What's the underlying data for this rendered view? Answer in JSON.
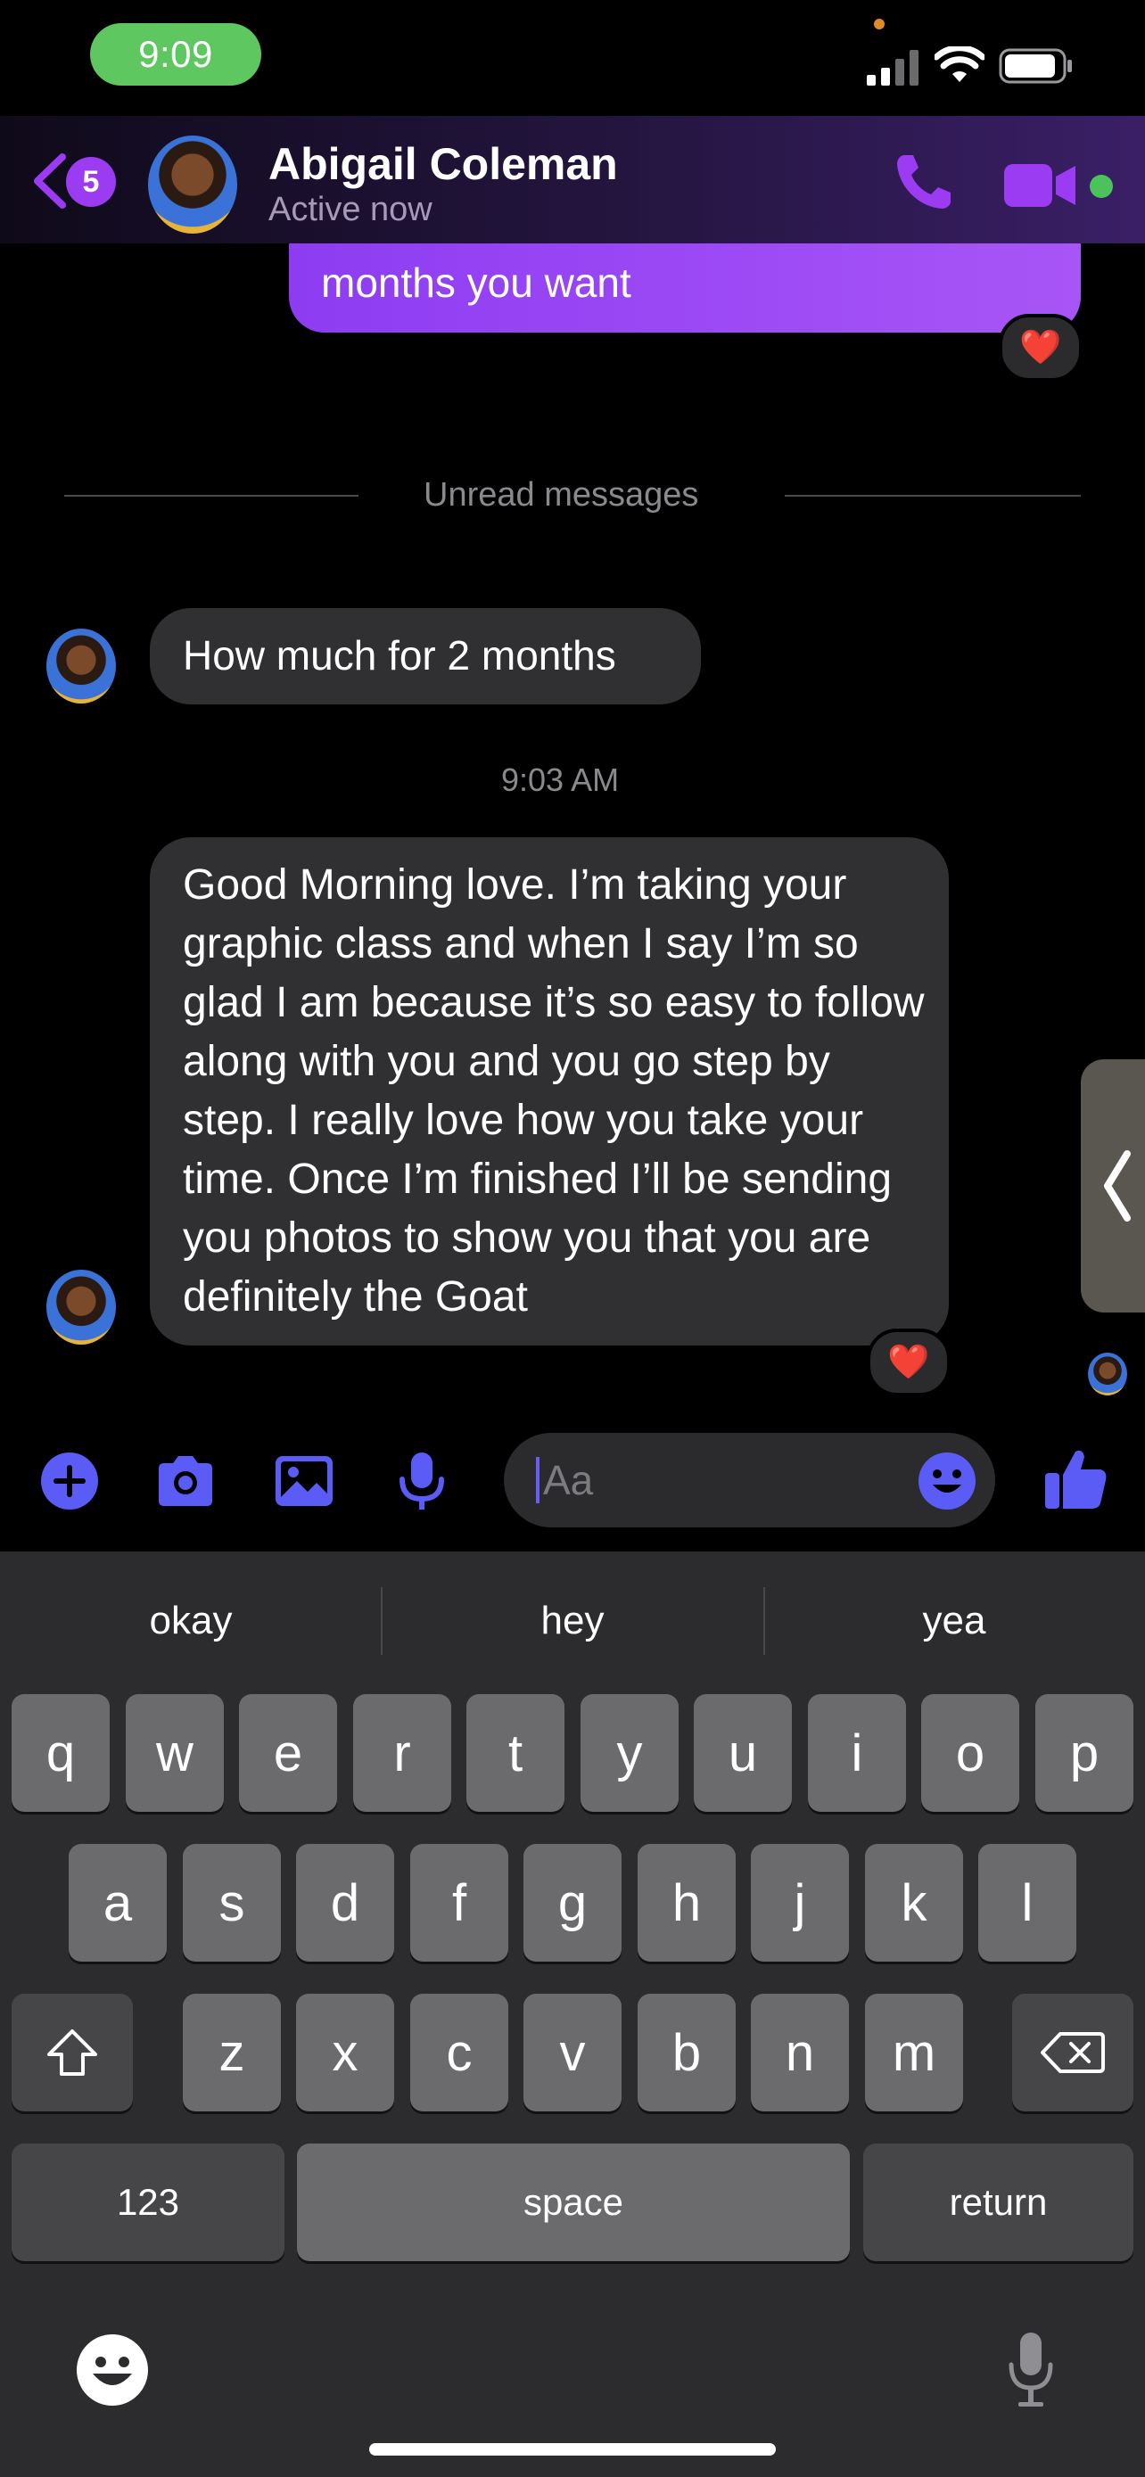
{
  "status_bar": {
    "time": "9:09"
  },
  "header": {
    "back_badge_count": "5",
    "contact_name": "Abigail Coleman",
    "contact_status": "Active now"
  },
  "messages": {
    "outgoing_partial_text": "months you want",
    "unread_divider": "Unread messages",
    "incoming_1": "How much for 2 months",
    "timestamp": "9:03 AM",
    "incoming_2": "Good Morning love. I’m taking your graphic class and when I say I’m so glad I am because it’s so easy to follow along with you and you go step by step. I really love how you take your time. Once I’m finished I’ll be sending you photos to show you that you are definitely the Goat",
    "reaction_emoji": "❤️"
  },
  "composer": {
    "placeholder": "Aa"
  },
  "keyboard": {
    "suggestions": [
      "okay",
      "hey",
      "yea"
    ],
    "row1": [
      "q",
      "w",
      "e",
      "r",
      "t",
      "y",
      "u",
      "i",
      "o",
      "p"
    ],
    "row2": [
      "a",
      "s",
      "d",
      "f",
      "g",
      "h",
      "j",
      "k",
      "l"
    ],
    "row3": [
      "z",
      "x",
      "c",
      "v",
      "b",
      "n",
      "m"
    ],
    "numbers_label": "123",
    "space_label": "space",
    "return_label": "return"
  },
  "colors": {
    "accent_purple": "#8e3cf2",
    "icon_blue": "#5b5cf6",
    "online_green": "#4bc25a"
  }
}
